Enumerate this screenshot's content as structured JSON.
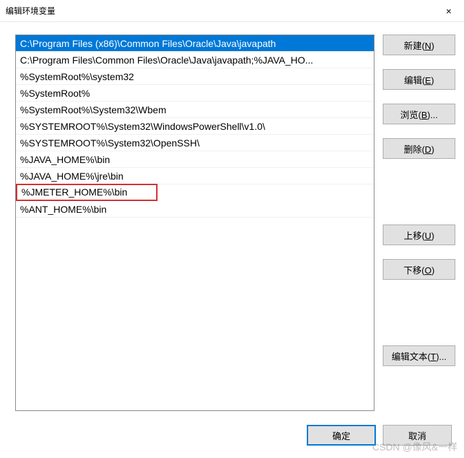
{
  "dialog": {
    "title": "编辑环境变量",
    "close": "×"
  },
  "list": {
    "items": [
      "C:\\Program Files (x86)\\Common Files\\Oracle\\Java\\javapath",
      "C:\\Program Files\\Common Files\\Oracle\\Java\\javapath;%JAVA_HO...",
      "%SystemRoot%\\system32",
      "%SystemRoot%",
      "%SystemRoot%\\System32\\Wbem",
      "%SYSTEMROOT%\\System32\\WindowsPowerShell\\v1.0\\",
      "%SYSTEMROOT%\\System32\\OpenSSH\\",
      "%JAVA_HOME%\\bin",
      "%JAVA_HOME%\\jre\\bin",
      "%JMETER_HOME%\\bin",
      "%ANT_HOME%\\bin"
    ],
    "selectedIndex": 0,
    "highlightIndex": 9
  },
  "buttons": {
    "new": {
      "label": "新建(",
      "mnemonic": "N",
      "suffix": ")"
    },
    "edit": {
      "label": "编辑(",
      "mnemonic": "E",
      "suffix": ")"
    },
    "browse": {
      "label": "浏览(",
      "mnemonic": "B",
      "suffix": ")..."
    },
    "delete": {
      "label": "删除(",
      "mnemonic": "D",
      "suffix": ")"
    },
    "moveUp": {
      "label": "上移(",
      "mnemonic": "U",
      "suffix": ")"
    },
    "moveDown": {
      "label": "下移(",
      "mnemonic": "O",
      "suffix": ")"
    },
    "editText": {
      "label": "编辑文本(",
      "mnemonic": "T",
      "suffix": ")..."
    },
    "ok": {
      "label": "确定"
    },
    "cancel": {
      "label": "取消"
    }
  },
  "watermark": "CSDN @像风&一样"
}
